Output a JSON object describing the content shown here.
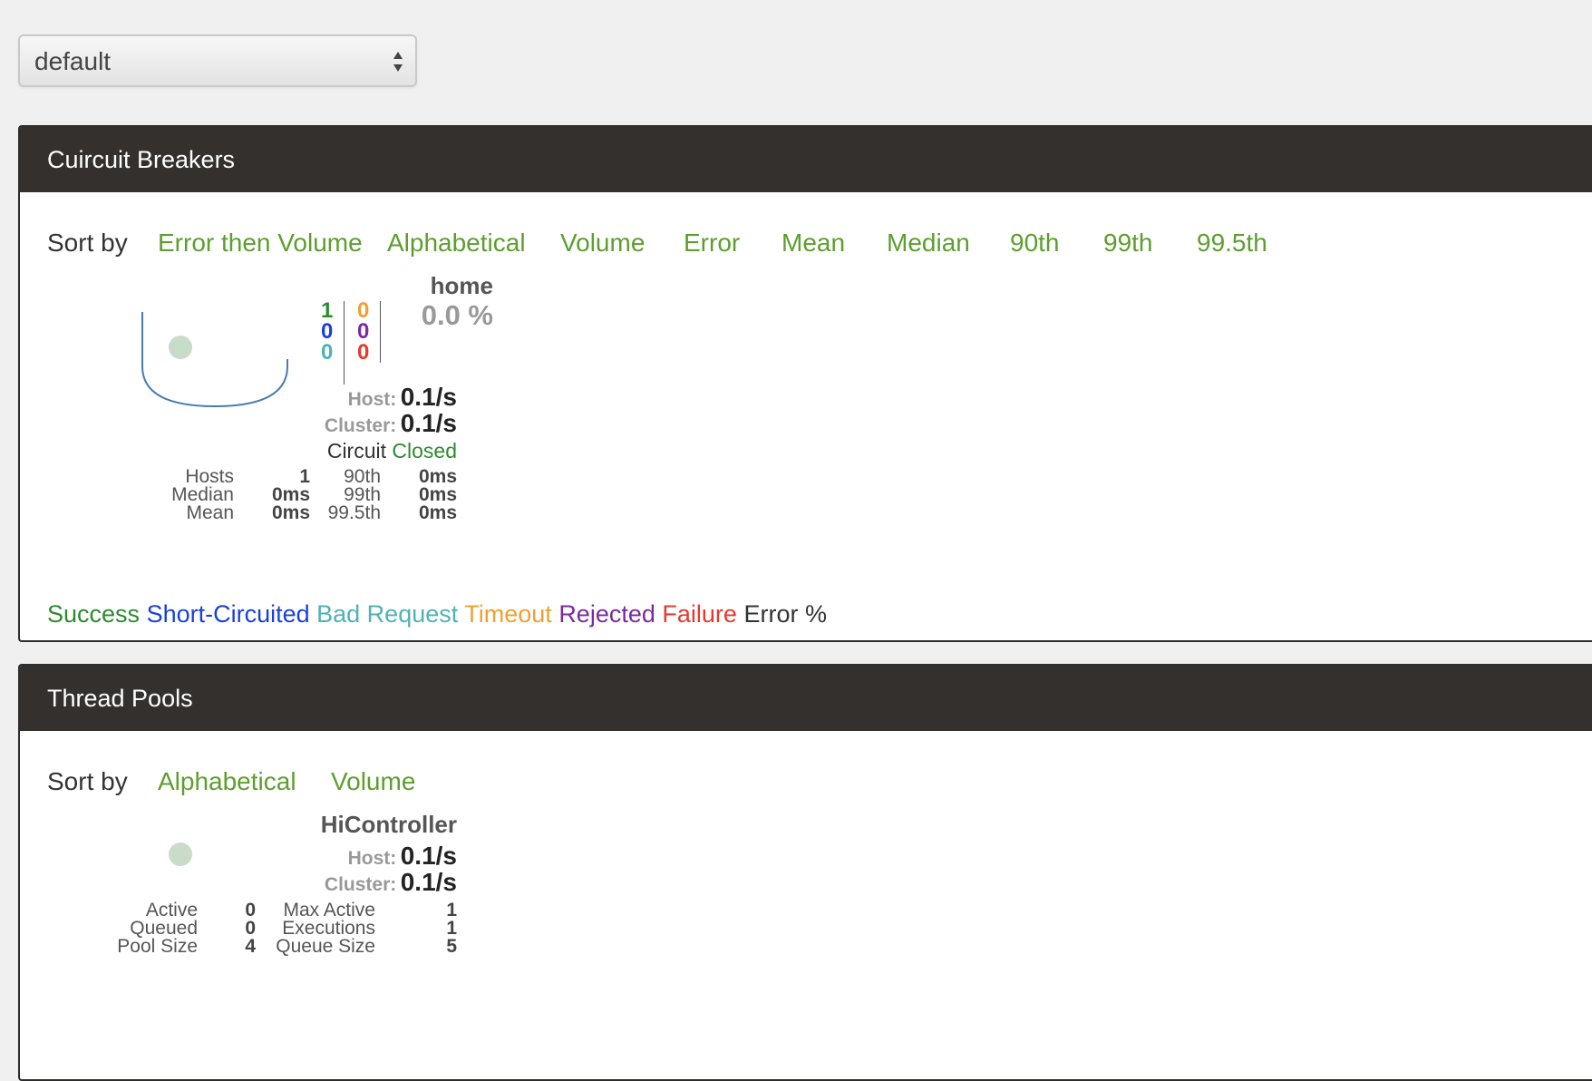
{
  "select": {
    "value": "default"
  },
  "circuit_breakers": {
    "title": "Cuircuit Breakers",
    "sort_label": "Sort by",
    "sort_options": [
      "Error then Volume",
      "Alphabetical",
      "Volume",
      "Error",
      "Mean",
      "Median",
      "90th",
      "99th",
      "99.5th"
    ],
    "card": {
      "name": "home",
      "error_pct": "0.0 %",
      "counts_left": [
        "1",
        "0",
        "0"
      ],
      "counts_right": [
        "0",
        "0",
        "0"
      ],
      "host_label": "Host:",
      "host_value": "0.1/s",
      "cluster_label": "Cluster:",
      "cluster_value": "0.1/s",
      "circuit_label": "Circuit",
      "circuit_status": "Closed",
      "stats": {
        "hosts_label": "Hosts",
        "hosts_value": "1",
        "median_label": "Median",
        "median_value": "0ms",
        "mean_label": "Mean",
        "mean_value": "0ms",
        "p90_label": "90th",
        "p90_value": "0ms",
        "p99_label": "99th",
        "p99_value": "0ms",
        "p995_label": "99.5th",
        "p995_value": "0ms"
      }
    },
    "legend": [
      "Success",
      "Short-Circuited",
      "Bad Request",
      "Timeout",
      "Rejected",
      "Failure",
      "Error %"
    ]
  },
  "thread_pools": {
    "title": "Thread Pools",
    "sort_label": "Sort by",
    "sort_options": [
      "Alphabetical",
      "Volume"
    ],
    "card": {
      "name": "HiController",
      "host_label": "Host:",
      "host_value": "0.1/s",
      "cluster_label": "Cluster:",
      "cluster_value": "0.1/s",
      "stats": {
        "active_label": "Active",
        "active_value": "0",
        "queued_label": "Queued",
        "queued_value": "0",
        "pool_size_label": "Pool Size",
        "pool_size_value": "4",
        "max_active_label": "Max Active",
        "max_active_value": "1",
        "executions_label": "Executions",
        "executions_value": "1",
        "queue_size_label": "Queue Size",
        "queue_size_value": "5"
      }
    }
  },
  "colors": {
    "success": "#2e8b2e",
    "short_circuited": "#1a3fe0",
    "bad_request": "#4fb3b3",
    "timeout": "#f0a030",
    "rejected": "#7b2a9e",
    "failure": "#e53a2e",
    "sort_link": "#5d9e2f",
    "header_bg": "#33302e"
  }
}
